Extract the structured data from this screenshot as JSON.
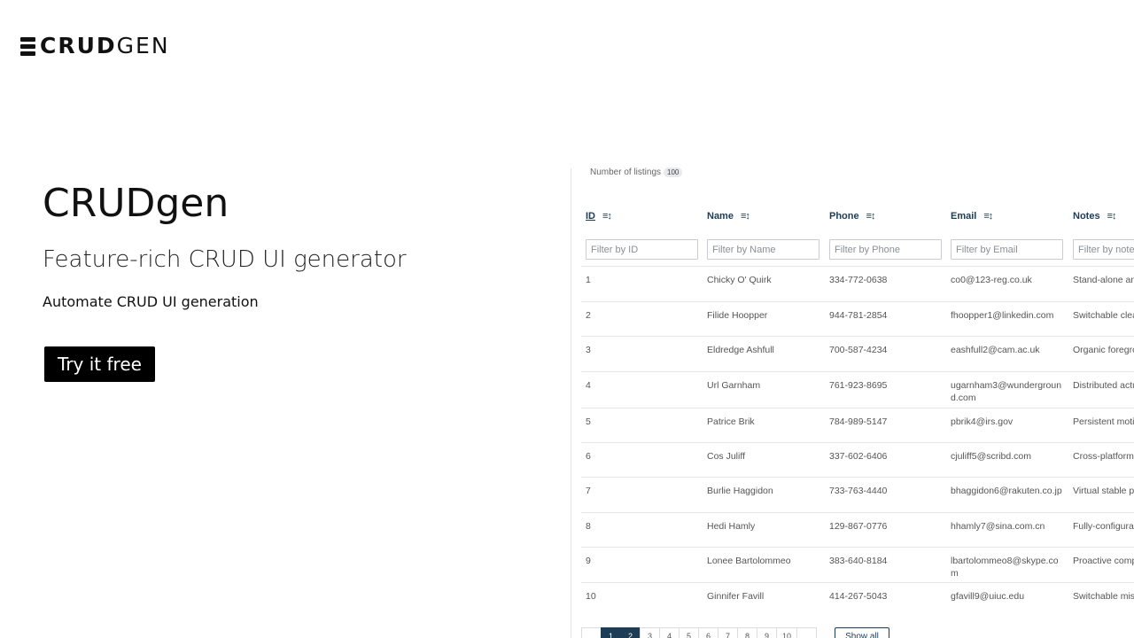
{
  "brand": {
    "bold": "CRUD",
    "light": "GEN"
  },
  "hero": {
    "title": "CRUDgen",
    "subtitle": "Feature-rich CRUD UI generator",
    "description": "Automate CRUD UI generation",
    "cta_label": "Try it free"
  },
  "preview": {
    "count_label": "Number of listings",
    "count_value": "100",
    "columns": [
      {
        "label": "ID",
        "filter_placeholder": "Filter by ID"
      },
      {
        "label": "Name",
        "filter_placeholder": "Filter by Name"
      },
      {
        "label": "Phone",
        "filter_placeholder": "Filter by Phone"
      },
      {
        "label": "Email",
        "filter_placeholder": "Filter by Email"
      },
      {
        "label": "Notes",
        "filter_placeholder": "Filter by notes"
      }
    ],
    "rows": [
      {
        "id": "1",
        "name": "Chicky O' Quirk",
        "phone": "334-772-0638",
        "email": "co0@123-reg.co.uk",
        "notes": "Stand-alone and"
      },
      {
        "id": "2",
        "name": "Filide Hoopper",
        "phone": "944-781-2854",
        "email": "fhoopper1@linkedin.com",
        "notes": "Switchable clear"
      },
      {
        "id": "3",
        "name": "Eldredge Ashfull",
        "phone": "700-587-4234",
        "email": "eashfull2@cam.ac.uk",
        "notes": "Organic foregro"
      },
      {
        "id": "4",
        "name": "Url Garnham",
        "phone": "761-923-8695",
        "email": "ugarnham3@wunderground.com",
        "notes": "Distributed actu"
      },
      {
        "id": "5",
        "name": "Patrice Brik",
        "phone": "784-989-5147",
        "email": "pbrik4@irs.gov",
        "notes": "Persistent motiv"
      },
      {
        "id": "6",
        "name": "Cos Juliff",
        "phone": "337-602-6406",
        "email": "cjuliff5@scribd.com",
        "notes": "Cross-platform"
      },
      {
        "id": "7",
        "name": "Burlie Haggidon",
        "phone": "733-763-4440",
        "email": "bhaggidon6@rakuten.co.jp",
        "notes": "Virtual stable pr"
      },
      {
        "id": "8",
        "name": "Hedi Hamly",
        "phone": "129-867-0776",
        "email": "hhamly7@sina.com.cn",
        "notes": "Fully-configurab"
      },
      {
        "id": "9",
        "name": "Lonee Bartolommeo",
        "phone": "383-640-8184",
        "email": "lbartolommeo8@skype.com",
        "notes": "Proactive comp"
      },
      {
        "id": "10",
        "name": "Ginnifer Favill",
        "phone": "414-267-5043",
        "email": "gfavill9@uiuc.edu",
        "notes": "Switchable miss"
      }
    ],
    "pagination": {
      "pages": [
        "",
        "1",
        "2",
        "3",
        "4",
        "5",
        "6",
        "7",
        "8",
        "9",
        "10",
        ""
      ],
      "show_all_label": "Show all"
    },
    "sort_icon": "sort-icon"
  }
}
